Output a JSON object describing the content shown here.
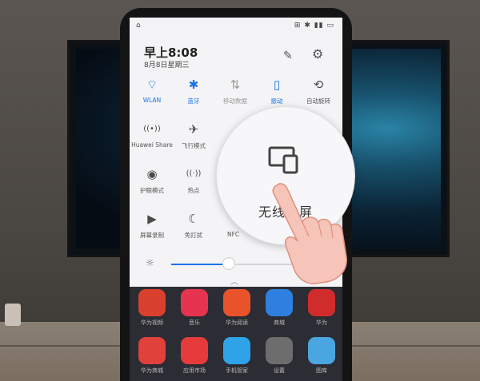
{
  "status": {
    "left": "⌂",
    "right": "⊞ ✱ ▮▮ ▭"
  },
  "header": {
    "time": "早上8:08",
    "date": "8月8日星期三"
  },
  "toggles": [
    {
      "label": "WLAN",
      "icon": "wifi-icon",
      "glyph": "⌔",
      "state": "on"
    },
    {
      "label": "蓝牙",
      "icon": "bluetooth-icon",
      "glyph": "✱",
      "state": "on"
    },
    {
      "label": "移动数据",
      "icon": "mobile-data-icon",
      "glyph": "⇅",
      "state": "dim"
    },
    {
      "label": "振动",
      "icon": "vibrate-icon",
      "glyph": "▯",
      "state": "on"
    },
    {
      "label": "自动旋转",
      "icon": "rotate-icon",
      "glyph": "⟲",
      "state": "off"
    },
    {
      "label": "Huawei Share",
      "icon": "huawei-share-icon",
      "glyph": "((•))",
      "state": "off"
    },
    {
      "label": "飞行模式",
      "icon": "airplane-icon",
      "glyph": "✈",
      "state": "off"
    },
    {
      "label": "护眼模式",
      "icon": "eye-comfort-icon",
      "glyph": "◉",
      "state": "off"
    },
    {
      "label": "热点",
      "icon": "hotspot-icon",
      "glyph": "((·))",
      "state": "off"
    },
    {
      "label": "屏幕录制",
      "icon": "screen-record-icon",
      "glyph": "▶",
      "state": "off"
    },
    {
      "label": "免打扰",
      "icon": "do-not-disturb-icon",
      "glyph": "☾",
      "state": "off"
    },
    {
      "label": "NFC",
      "icon": "nfc-icon",
      "glyph": "",
      "state": "off"
    }
  ],
  "brightness": {
    "level": 0.45
  },
  "magnified": {
    "label": "无线投屏",
    "icon": "wireless-projection-icon"
  },
  "apps": [
    {
      "name": "华为视频",
      "color": "#d9412e"
    },
    {
      "name": "音乐",
      "color": "#e6334f"
    },
    {
      "name": "华为阅读",
      "color": "#e8532b"
    },
    {
      "name": "商城",
      "color": "#2f7fe0"
    },
    {
      "name": "华为",
      "color": "#d02c2c"
    },
    {
      "name": "华为商城",
      "color": "#e0413a"
    },
    {
      "name": "应用市场",
      "color": "#e53b3b"
    },
    {
      "name": "手机管家",
      "color": "#2fa3e8"
    },
    {
      "name": "设置",
      "color": "#6d6d6d"
    },
    {
      "name": "图库",
      "color": "#4aa6e0"
    }
  ]
}
